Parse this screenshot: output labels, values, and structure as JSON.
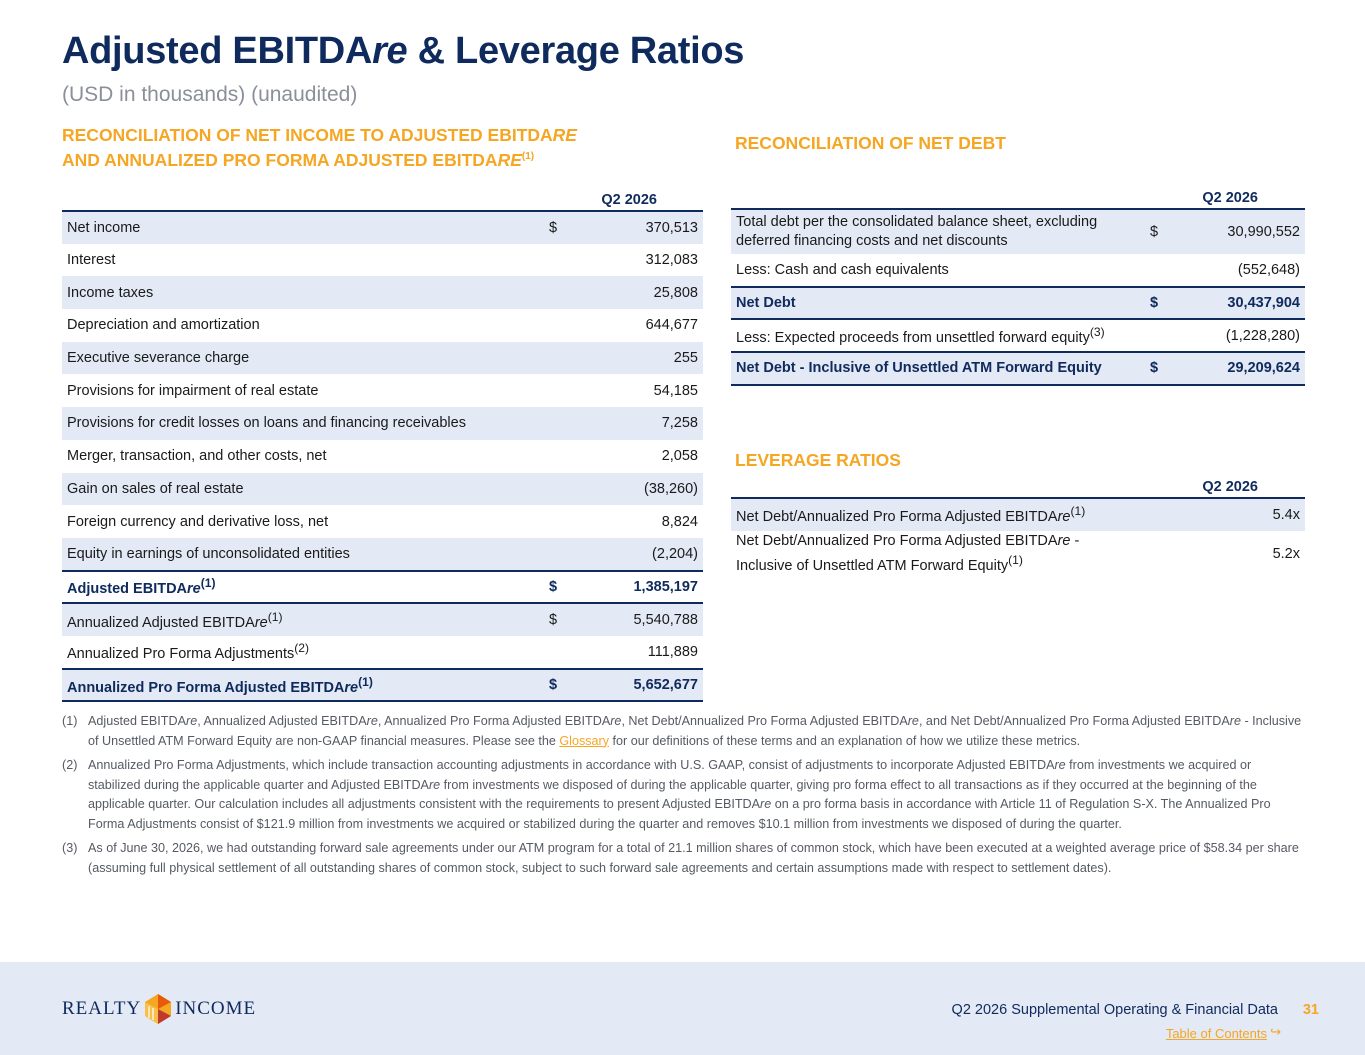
{
  "header": {
    "title_prefix": "Adjusted EBITDA",
    "title_italic": "re",
    "title_suffix": " & Leverage Ratios",
    "subtitle": "(USD in thousands) (unaudited)"
  },
  "left_section": {
    "heading_line1_prefix": "RECONCILIATION OF NET INCOME TO ADJUSTED EBITDA",
    "heading_line1_italic": "re",
    "heading_line2_prefix": "AND ANNUALIZED PRO FORMA ADJUSTED EBITDA",
    "heading_line2_italic": "re",
    "heading_line2_sup": "(1)",
    "period": "Q2 2026",
    "rows": [
      {
        "label": "Net income",
        "dollar": "$",
        "value": "370,513"
      },
      {
        "label": "Interest",
        "dollar": "",
        "value": "312,083"
      },
      {
        "label": "Income taxes",
        "dollar": "",
        "value": "25,808"
      },
      {
        "label": "Depreciation and amortization",
        "dollar": "",
        "value": "644,677"
      },
      {
        "label": "Executive severance charge",
        "dollar": "",
        "value": "255"
      },
      {
        "label": "Provisions for impairment of real estate",
        "dollar": "",
        "value": "54,185"
      },
      {
        "label": "Provisions for credit losses on loans and financing receivables",
        "dollar": "",
        "value": "7,258"
      },
      {
        "label": "Merger, transaction, and other costs, net",
        "dollar": "",
        "value": "2,058"
      },
      {
        "label": "Gain on sales of real estate",
        "dollar": "",
        "value": "(38,260)"
      },
      {
        "label": "Foreign currency and derivative loss, net",
        "dollar": "",
        "value": "8,824"
      },
      {
        "label": "Equity in earnings of unconsolidated entities",
        "dollar": "",
        "value": "(2,204)"
      }
    ],
    "adjusted": {
      "label_prefix": "Adjusted EBITDA",
      "label_italic": "re",
      "sup": "(1)",
      "dollar": "$",
      "value": "1,385,197"
    },
    "annualized": {
      "label_prefix": "Annualized Adjusted EBITDA",
      "label_italic": "re",
      "sup": "(1)",
      "dollar": "$",
      "value": "5,540,788"
    },
    "pro_forma_adj": {
      "label": "Annualized Pro Forma Adjustments",
      "sup": "(2)",
      "dollar": "",
      "value": "111,889"
    },
    "pro_forma_total": {
      "label_prefix": "Annualized Pro Forma Adjusted EBITDA",
      "label_italic": "re",
      "sup": "(1)",
      "dollar": "$",
      "value": "5,652,677"
    }
  },
  "net_debt_section": {
    "heading": "RECONCILIATION OF NET DEBT",
    "period": "Q2 2026",
    "total_debt": {
      "label": "Total debt per the consolidated balance sheet, excluding deferred financing costs and net discounts",
      "dollar": "$",
      "value": "30,990,552"
    },
    "cash": {
      "label": "Less: Cash and cash equivalents",
      "dollar": "",
      "value": "(552,648)"
    },
    "net_debt": {
      "label": "Net Debt",
      "dollar": "$",
      "value": "30,437,904"
    },
    "forward_equity": {
      "label": "Less: Expected proceeds from unsettled forward equity",
      "sup": "(3)",
      "dollar": "",
      "value": "(1,228,280)"
    },
    "net_debt_inclusive": {
      "label": "Net Debt - Inclusive of Unsettled ATM Forward Equity",
      "dollar": "$",
      "value": "29,209,624"
    }
  },
  "leverage_section": {
    "heading": "LEVERAGE RATIOS",
    "period": "Q2 2026",
    "ratio1": {
      "label_prefix": "Net Debt/Annualized Pro Forma Adjusted EBITDA",
      "label_italic": "re",
      "sup": "(1)",
      "value": "5.4x"
    },
    "ratio2": {
      "label_line1_prefix": "Net Debt/Annualized Pro Forma Adjusted EBITDA",
      "label_line1_italic": "re",
      "label_line1_suffix": " -",
      "label_line2": "Inclusive of Unsettled ATM Forward Equity",
      "sup": "(1)",
      "value": "5.2x"
    }
  },
  "footnotes": {
    "fn1_num": "(1)",
    "fn1_a": "Adjusted EBITDA",
    "fn1_b": ", Annualized Adjusted EBITDA",
    "fn1_c": ", Annualized Pro Forma Adjusted EBITDA",
    "fn1_d": ", Net Debt/Annualized Pro Forma Adjusted EBITDA",
    "fn1_e": ", and Net Debt/Annualized Pro Forma Adjusted EBITDA",
    "fn1_f": " - Inclusive of Unsettled ATM Forward Equity are non-GAAP financial measures. Please see the ",
    "fn1_link": "Glossary",
    "fn1_g": " for our definitions of these terms and an explanation of how we utilize these metrics.",
    "fn_italic": "re",
    "fn2_num": "(2)",
    "fn2_a": "Annualized Pro Forma Adjustments, which include transaction accounting adjustments in accordance with U.S. GAAP, consist of adjustments to incorporate Adjusted EBITDA",
    "fn2_b": " from investments we acquired or stabilized during the applicable quarter and Adjusted EBITDA",
    "fn2_c": " from investments we disposed of during the applicable quarter, giving pro forma effect to all transactions as if they occurred at the beginning of the applicable quarter. Our calculation includes all adjustments consistent with the requirements to present Adjusted EBITDA",
    "fn2_d": " on a pro forma basis in accordance with Article 11 of Regulation S-X. The Annualized Pro Forma Adjustments consist of $121.9 million from investments we acquired or stabilized during the quarter and removes $10.1 million from investments we disposed of during the quarter.",
    "fn3_num": "(3)",
    "fn3": "As of June 30, 2026, we had outstanding forward sale agreements under our ATM program for a total of 21.1 million shares of common stock, which have been executed at a weighted average price of $58.34 per share (assuming full physical settlement of all outstanding shares of common stock, subject to such forward sale agreements and certain assumptions made with respect to settlement dates)."
  },
  "footer": {
    "logo_left": "REALTY",
    "logo_right": "INCOME",
    "doc_title": "Q2 2026 Supplemental Operating & Financial Data",
    "page_number": "31",
    "toc_link": "Table of Contents",
    "toc_arrow": "↪"
  },
  "colors": {
    "navy": "#0f2a5c",
    "orange": "#f5a623",
    "shade": "#e3e9f5"
  }
}
